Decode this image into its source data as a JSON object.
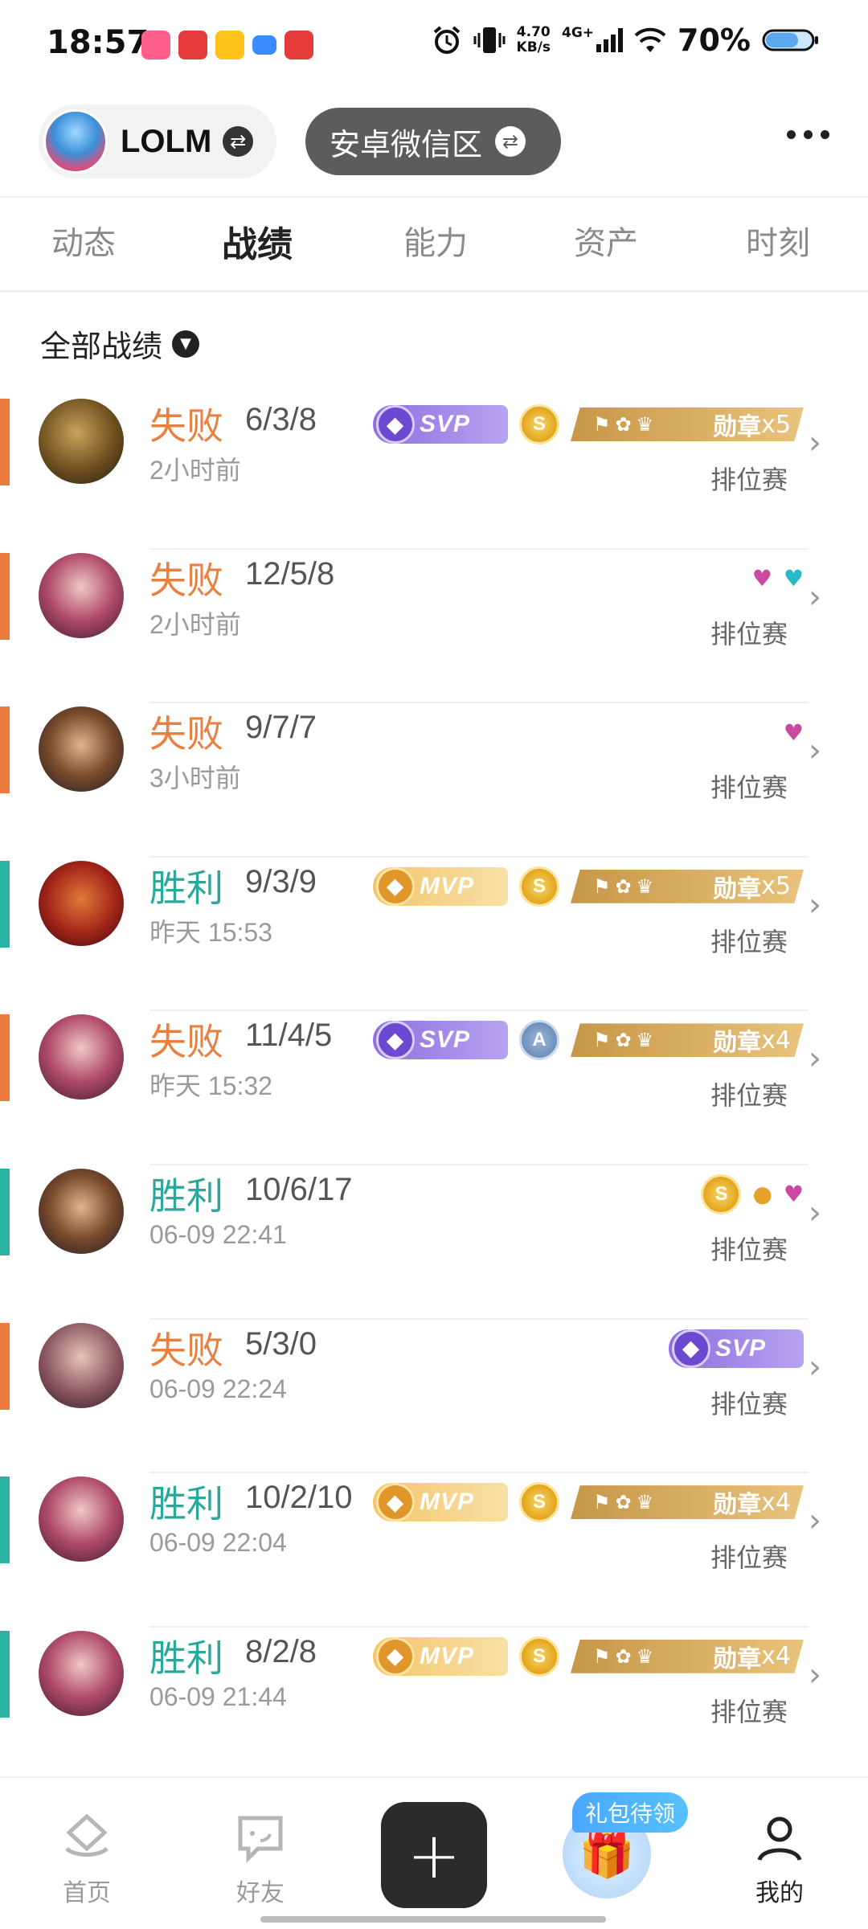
{
  "status_bar": {
    "time": "18:57",
    "speed_value": "4.70",
    "speed_unit": "KB/s",
    "network": "4G+",
    "battery": "70%",
    "icons": [
      "alarm-icon",
      "vibrate-icon",
      "signal-icon",
      "wifi-icon",
      "battery-icon"
    ]
  },
  "header": {
    "game_name": "LOLM",
    "region": "安卓微信区"
  },
  "tabs": [
    {
      "label": "动态"
    },
    {
      "label": "战绩",
      "active": true
    },
    {
      "label": "能力"
    },
    {
      "label": "资产"
    },
    {
      "label": "时刻"
    }
  ],
  "filter": {
    "label": "全部战绩"
  },
  "matches": [
    {
      "result": "失败",
      "kda": "6/3/8",
      "time": "2小时前",
      "mode": "排位赛",
      "rank_badge": "SVP",
      "coin": "S",
      "medal_label": "勋章",
      "medal_count": "x5"
    },
    {
      "result": "失败",
      "kda": "12/5/8",
      "time": "2小时前",
      "mode": "排位赛",
      "rank_badge": "",
      "coin": "",
      "medal_label": "",
      "medal_count": ""
    },
    {
      "result": "失败",
      "kda": "9/7/7",
      "time": "3小时前",
      "mode": "排位赛",
      "rank_badge": "",
      "coin": "",
      "medal_label": "",
      "medal_count": ""
    },
    {
      "result": "胜利",
      "kda": "9/3/9",
      "time": "昨天 15:53",
      "mode": "排位赛",
      "rank_badge": "MVP",
      "coin": "S",
      "medal_label": "勋章",
      "medal_count": "x5"
    },
    {
      "result": "失败",
      "kda": "11/4/5",
      "time": "昨天 15:32",
      "mode": "排位赛",
      "rank_badge": "SVP",
      "coin": "A",
      "medal_label": "勋章",
      "medal_count": "x4"
    },
    {
      "result": "胜利",
      "kda": "10/6/17",
      "time": "06-09 22:41",
      "mode": "排位赛",
      "rank_badge": "",
      "coin": "S",
      "medal_label": "",
      "medal_count": ""
    },
    {
      "result": "失败",
      "kda": "5/3/0",
      "time": "06-09 22:24",
      "mode": "排位赛",
      "rank_badge": "SVP",
      "coin": "",
      "medal_label": "",
      "medal_count": ""
    },
    {
      "result": "胜利",
      "kda": "10/2/10",
      "time": "06-09 22:04",
      "mode": "排位赛",
      "rank_badge": "MVP",
      "coin": "S",
      "medal_label": "勋章",
      "medal_count": "x4"
    },
    {
      "result": "胜利",
      "kda": "8/2/8",
      "time": "06-09 21:44",
      "mode": "排位赛",
      "rank_badge": "MVP",
      "coin": "S",
      "medal_label": "勋章",
      "medal_count": "x4"
    }
  ],
  "bottom_nav": {
    "home": "首页",
    "friends": "好友",
    "gift_tag": "礼包待领",
    "me": "我的"
  },
  "colors": {
    "lose": "#ee7a3b",
    "win": "#29b3a4"
  }
}
